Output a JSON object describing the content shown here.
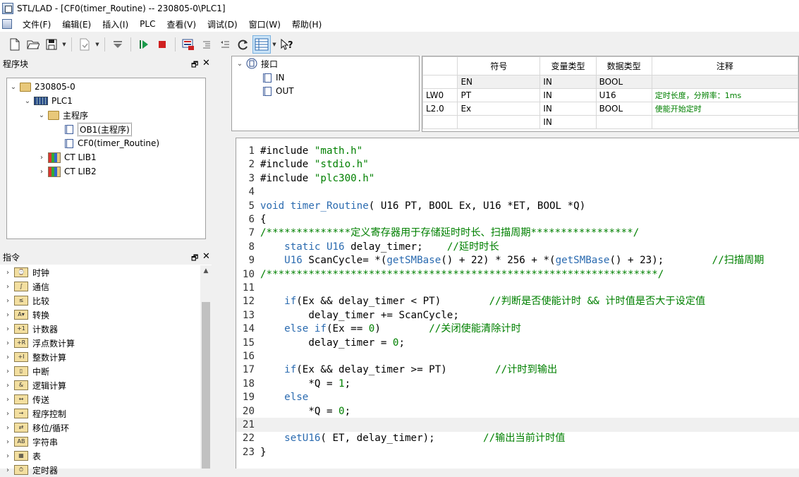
{
  "window": {
    "title": "STL/LAD - [CF0(timer_Routine) -- 230805-0\\PLC1]"
  },
  "menu": [
    "文件(F)",
    "编辑(E)",
    "插入(I)",
    "PLC",
    "查看(V)",
    "调试(D)",
    "窗口(W)",
    "帮助(H)"
  ],
  "toolbar": {
    "icons": [
      "new-file-icon",
      "open-folder-icon",
      "save-icon",
      "export-icon",
      "filter-icon",
      "run-icon",
      "stop-icon",
      "monitor-icon",
      "indent-icon",
      "compile-icon",
      "refresh-icon",
      "table-view-icon",
      "context-help-icon"
    ]
  },
  "program_panel": {
    "title": "程序块",
    "tree": [
      {
        "label": "230805-0"
      },
      {
        "label": "PLC1"
      },
      {
        "label": "主程序"
      },
      {
        "label": "OB1(主程序)"
      },
      {
        "label": "CF0(timer_Routine)"
      },
      {
        "label": "CT LIB1"
      },
      {
        "label": "CT LIB2"
      }
    ]
  },
  "instruction_panel": {
    "title": "指令",
    "items": [
      {
        "label": "时钟",
        "icon": "⌚"
      },
      {
        "label": "通信",
        "icon": "∫"
      },
      {
        "label": "比较",
        "icon": "≤"
      },
      {
        "label": "转换",
        "icon": "A▾"
      },
      {
        "label": "计数器",
        "icon": "+1"
      },
      {
        "label": "浮点数计算",
        "icon": "+R"
      },
      {
        "label": "整数计算",
        "icon": "+I"
      },
      {
        "label": "中断",
        "icon": "▯"
      },
      {
        "label": "逻辑计算",
        "icon": "&"
      },
      {
        "label": "传送",
        "icon": "↔"
      },
      {
        "label": "程序控制",
        "icon": "→"
      },
      {
        "label": "移位/循环",
        "icon": "⇄"
      },
      {
        "label": "字符串",
        "icon": "AB"
      },
      {
        "label": "表",
        "icon": "▦"
      },
      {
        "label": "定时器",
        "icon": "⏱"
      }
    ]
  },
  "interface": {
    "root": "接口",
    "children": [
      "IN",
      "OUT"
    ]
  },
  "var_table": {
    "headers": {
      "addr": "",
      "symbol": "符号",
      "var_type": "变量类型",
      "data_type": "数据类型",
      "comment": "注释"
    },
    "rows": [
      {
        "addr": "",
        "symbol": "EN",
        "var_type": "IN",
        "data_type": "BOOL",
        "comment": ""
      },
      {
        "addr": "LW0",
        "symbol": "PT",
        "var_type": "IN",
        "data_type": "U16",
        "comment": "定时长度，分辨率：1ms"
      },
      {
        "addr": "L2.0",
        "symbol": "Ex",
        "var_type": "IN",
        "data_type": "BOOL",
        "comment": "使能开始定时"
      },
      {
        "addr": "",
        "symbol": "",
        "var_type": "IN",
        "data_type": "",
        "comment": ""
      }
    ]
  },
  "code": {
    "current_line": 21,
    "lines": [
      {
        "n": "1",
        "segs": [
          [
            "p",
            "#include "
          ],
          [
            "s",
            "\"math.h\""
          ]
        ]
      },
      {
        "n": "2",
        "segs": [
          [
            "p",
            "#include "
          ],
          [
            "s",
            "\"stdio.h\""
          ]
        ]
      },
      {
        "n": "3",
        "segs": [
          [
            "p",
            "#include "
          ],
          [
            "s",
            "\"plc300.h\""
          ]
        ]
      },
      {
        "n": "4",
        "segs": []
      },
      {
        "n": "5",
        "segs": [
          [
            "k",
            "void"
          ],
          [
            "p",
            " "
          ],
          [
            "f",
            "timer_Routine"
          ],
          [
            "p",
            "( U16 PT, BOOL Ex, U16 *ET, BOOL *Q)"
          ]
        ]
      },
      {
        "n": "6",
        "segs": [
          [
            "p",
            "{"
          ]
        ]
      },
      {
        "n": "7",
        "segs": [
          [
            "c",
            "/**************定义寄存器用于存储延时时长、扫描周期*****************/"
          ]
        ]
      },
      {
        "n": "8",
        "segs": [
          [
            "p",
            "    "
          ],
          [
            "k",
            "static"
          ],
          [
            "p",
            " "
          ],
          [
            "k",
            "U16"
          ],
          [
            "p",
            " delay_timer;    "
          ],
          [
            "c",
            "//延时时长"
          ]
        ]
      },
      {
        "n": "9",
        "segs": [
          [
            "p",
            "    "
          ],
          [
            "k",
            "U16"
          ],
          [
            "p",
            " ScanCycle= *("
          ],
          [
            "f",
            "getSMBase"
          ],
          [
            "p",
            "() + 22) * 256 + *("
          ],
          [
            "f",
            "getSMBase"
          ],
          [
            "p",
            "() + 23);        "
          ],
          [
            "c",
            "//扫描周期"
          ]
        ]
      },
      {
        "n": "10",
        "segs": [
          [
            "c",
            "/*****************************************************************/"
          ]
        ]
      },
      {
        "n": "11",
        "segs": []
      },
      {
        "n": "12",
        "segs": [
          [
            "p",
            "    "
          ],
          [
            "k",
            "if"
          ],
          [
            "p",
            "(Ex && delay_timer < PT)        "
          ],
          [
            "c",
            "//判断是否使能计时 && 计时值是否大于设定值"
          ]
        ]
      },
      {
        "n": "13",
        "segs": [
          [
            "p",
            "        delay_timer += ScanCycle;"
          ]
        ]
      },
      {
        "n": "14",
        "segs": [
          [
            "p",
            "    "
          ],
          [
            "k",
            "else"
          ],
          [
            "p",
            " "
          ],
          [
            "k",
            "if"
          ],
          [
            "p",
            "(Ex == "
          ],
          [
            "n",
            "0"
          ],
          [
            "p",
            ")        "
          ],
          [
            "c",
            "//关闭使能清除计时"
          ]
        ]
      },
      {
        "n": "15",
        "segs": [
          [
            "p",
            "        delay_timer = "
          ],
          [
            "n",
            "0"
          ],
          [
            "p",
            ";"
          ]
        ]
      },
      {
        "n": "16",
        "segs": []
      },
      {
        "n": "17",
        "segs": [
          [
            "p",
            "    "
          ],
          [
            "k",
            "if"
          ],
          [
            "p",
            "(Ex && delay_timer >= PT)        "
          ],
          [
            "c",
            "//计时到输出"
          ]
        ]
      },
      {
        "n": "18",
        "segs": [
          [
            "p",
            "        *Q = "
          ],
          [
            "n",
            "1"
          ],
          [
            "p",
            ";"
          ]
        ]
      },
      {
        "n": "19",
        "segs": [
          [
            "p",
            "    "
          ],
          [
            "k",
            "else"
          ]
        ]
      },
      {
        "n": "20",
        "segs": [
          [
            "p",
            "        *Q = "
          ],
          [
            "n",
            "0"
          ],
          [
            "p",
            ";"
          ]
        ]
      },
      {
        "n": "21",
        "segs": []
      },
      {
        "n": "22",
        "segs": [
          [
            "p",
            "    "
          ],
          [
            "f",
            "setU16"
          ],
          [
            "p",
            "( ET, delay_timer);        "
          ],
          [
            "c",
            "//输出当前计时值"
          ]
        ]
      },
      {
        "n": "23",
        "segs": [
          [
            "p",
            "}"
          ]
        ]
      }
    ]
  },
  "colors": {
    "keyword": "#2b6bb0",
    "comment": "#008000",
    "string": "#008000",
    "selected": "#cce4f7"
  }
}
